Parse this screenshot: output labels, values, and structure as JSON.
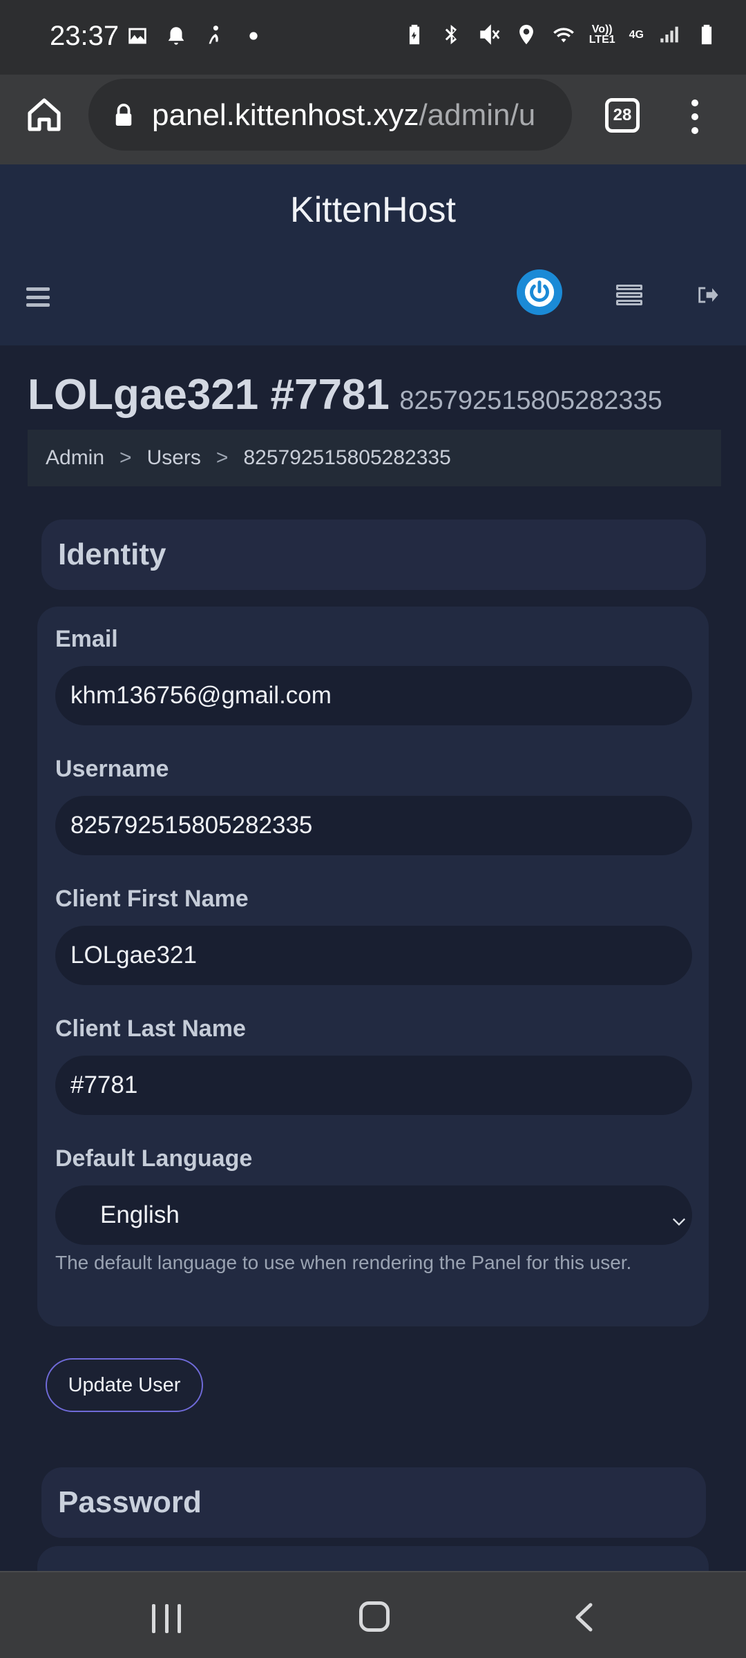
{
  "status_bar": {
    "time": "23:37",
    "network_top": "Vo))",
    "network_bottom": "LTE1",
    "network_type": "4G"
  },
  "browser": {
    "url_host": "panel.kittenhost.xyz",
    "url_path": "/admin/u",
    "tab_count": "28"
  },
  "site": {
    "brand": "KittenHost"
  },
  "page": {
    "title": "LOLgae321 #7781",
    "subtitle": "825792515805282335"
  },
  "breadcrumb": {
    "items": [
      "Admin",
      "Users",
      "825792515805282335"
    ],
    "separator": ">"
  },
  "identity": {
    "heading": "Identity",
    "email_label": "Email",
    "email_value": "khm136756@gmail.com",
    "username_label": "Username",
    "username_value": "825792515805282335",
    "first_name_label": "Client First Name",
    "first_name_value": "LOLgae321",
    "last_name_label": "Client Last Name",
    "last_name_value": "#7781",
    "language_label": "Default Language",
    "language_value": "English",
    "language_help": "The default language to use when rendering the Panel for this user."
  },
  "update_button": "Update User",
  "password": {
    "heading": "Password"
  },
  "colors": {
    "accent": "#1b8ad6",
    "button_border": "#6f6ad8"
  }
}
